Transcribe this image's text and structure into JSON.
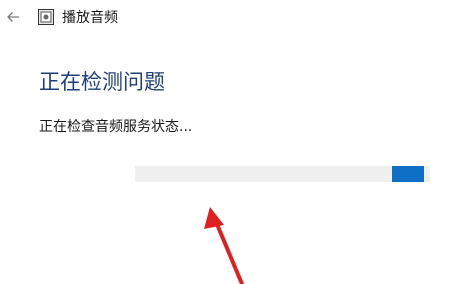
{
  "window": {
    "back_icon": "back-arrow-icon",
    "app_icon": "troubleshooter-icon",
    "title": "播放音频"
  },
  "main": {
    "heading": "正在检测问题",
    "status": "正在检查音频服务状态...",
    "progress": {
      "type": "indeterminate",
      "indicator_fraction": 0.98
    }
  },
  "colors": {
    "accent": "#0f6fc6",
    "heading": "#1f3f7a",
    "annotation_arrow": "#e02020",
    "progress_track": "#f0f0f0"
  },
  "annotation": {
    "icon": "red-arrow-icon"
  }
}
